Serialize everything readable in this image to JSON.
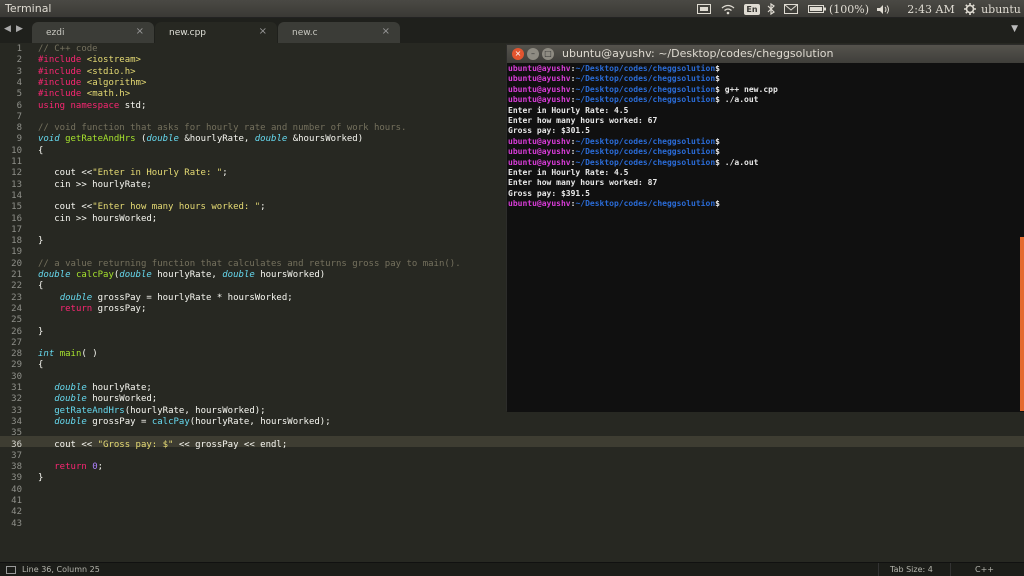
{
  "topbar": {
    "title": "Terminal",
    "tray": {
      "keyboard_layout": "En",
      "battery": "(100%)",
      "time": "2:43 AM",
      "user": "ubuntu",
      "icons": [
        "video-icon",
        "wifi-icon",
        "keyboard-icon",
        "bluetooth-icon",
        "mail-icon",
        "battery-icon",
        "volume-icon",
        "settings-gear-icon"
      ]
    }
  },
  "tabs": [
    {
      "label": "ezdi",
      "close": "×"
    },
    {
      "label": "new.cpp",
      "close": "×"
    },
    {
      "label": "new.c",
      "close": "×"
    }
  ],
  "nav": {
    "back": "◀",
    "forward": "▶",
    "menu": "▼"
  },
  "editor": {
    "line_numbers": [
      "1",
      "2",
      "3",
      "4",
      "5",
      "6",
      "7",
      "8",
      "9",
      "10",
      "11",
      "12",
      "13",
      "14",
      "15",
      "16",
      "17",
      "18",
      "19",
      "20",
      "21",
      "22",
      "23",
      "24",
      "25",
      "26",
      "27",
      "28",
      "29",
      "30",
      "31",
      "32",
      "33",
      "34",
      "35",
      "36",
      "37",
      "38",
      "39",
      "40",
      "41",
      "42",
      "43"
    ],
    "code": [
      [
        {
          "t": "// C++ code",
          "c": "cm"
        }
      ],
      [
        {
          "t": "#include ",
          "c": "kw"
        },
        {
          "t": "<iostream>",
          "c": "str"
        }
      ],
      [
        {
          "t": "#include ",
          "c": "kw"
        },
        {
          "t": "<stdio.h>",
          "c": "str"
        }
      ],
      [
        {
          "t": "#include ",
          "c": "kw"
        },
        {
          "t": "<algorithm>",
          "c": "str"
        }
      ],
      [
        {
          "t": "#include ",
          "c": "kw"
        },
        {
          "t": "<math.h>",
          "c": "str"
        }
      ],
      [
        {
          "t": "using namespace ",
          "c": "kw"
        },
        {
          "t": "std;",
          "c": ""
        }
      ],
      [],
      [
        {
          "t": "// void function that asks for hourly rate and number of work hours.",
          "c": "cm"
        }
      ],
      [
        {
          "t": "void ",
          "c": "ty"
        },
        {
          "t": "getRateAndHrs",
          "c": "fn"
        },
        {
          "t": " (",
          "c": ""
        },
        {
          "t": "double",
          "c": "ty"
        },
        {
          "t": " &hourlyRate, ",
          "c": ""
        },
        {
          "t": "double",
          "c": "ty"
        },
        {
          "t": " &hoursWorked)",
          "c": ""
        }
      ],
      [
        {
          "t": "{",
          "c": ""
        }
      ],
      [],
      [
        {
          "t": "   cout <<",
          "c": ""
        },
        {
          "t": "\"Enter in Hourly Rate: \"",
          "c": "str"
        },
        {
          "t": ";",
          "c": ""
        }
      ],
      [
        {
          "t": "   cin >> hourlyRate;",
          "c": ""
        }
      ],
      [],
      [
        {
          "t": "   cout <<",
          "c": ""
        },
        {
          "t": "\"Enter how many hours worked: \"",
          "c": "str"
        },
        {
          "t": ";",
          "c": ""
        }
      ],
      [
        {
          "t": "   cin >> hoursWorked;",
          "c": ""
        }
      ],
      [],
      [
        {
          "t": "}",
          "c": ""
        }
      ],
      [],
      [
        {
          "t": "// a value returning function that calculates and returns gross pay to main().",
          "c": "cm"
        }
      ],
      [
        {
          "t": "double ",
          "c": "ty"
        },
        {
          "t": "calcPay",
          "c": "fn"
        },
        {
          "t": "(",
          "c": ""
        },
        {
          "t": "double",
          "c": "ty"
        },
        {
          "t": " hourlyRate, ",
          "c": ""
        },
        {
          "t": "double",
          "c": "ty"
        },
        {
          "t": " hoursWorked)",
          "c": ""
        }
      ],
      [
        {
          "t": "{",
          "c": ""
        }
      ],
      [
        {
          "t": "    ",
          "c": ""
        },
        {
          "t": "double",
          "c": "ty"
        },
        {
          "t": " grossPay = hourlyRate * hoursWorked;",
          "c": ""
        }
      ],
      [
        {
          "t": "    ",
          "c": ""
        },
        {
          "t": "return",
          "c": "kw"
        },
        {
          "t": " grossPay;",
          "c": ""
        }
      ],
      [],
      [
        {
          "t": "}",
          "c": ""
        }
      ],
      [],
      [
        {
          "t": "int ",
          "c": "ty"
        },
        {
          "t": "main",
          "c": "fn"
        },
        {
          "t": "( )",
          "c": ""
        }
      ],
      [
        {
          "t": "{",
          "c": ""
        }
      ],
      [],
      [
        {
          "t": "   ",
          "c": ""
        },
        {
          "t": "double",
          "c": "ty"
        },
        {
          "t": " hourlyRate;",
          "c": ""
        }
      ],
      [
        {
          "t": "   ",
          "c": ""
        },
        {
          "t": "double",
          "c": "ty"
        },
        {
          "t": " hoursWorked;",
          "c": ""
        }
      ],
      [
        {
          "t": "   ",
          "c": ""
        },
        {
          "t": "getRateAndHrs",
          "c": "tp"
        },
        {
          "t": "(hourlyRate, hoursWorked);",
          "c": ""
        }
      ],
      [
        {
          "t": "   ",
          "c": ""
        },
        {
          "t": "double",
          "c": "ty"
        },
        {
          "t": " grossPay = ",
          "c": ""
        },
        {
          "t": "calcPay",
          "c": "tp"
        },
        {
          "t": "(hourlyRate, hoursWorked);",
          "c": ""
        }
      ],
      [],
      [
        {
          "t": "   cout << ",
          "c": ""
        },
        {
          "t": "\"Gross pay: $\"",
          "c": "str"
        },
        {
          "t": " << grossPay << endl;",
          "c": ""
        }
      ],
      [],
      [
        {
          "t": "   ",
          "c": ""
        },
        {
          "t": "return",
          "c": "kw"
        },
        {
          "t": " ",
          "c": ""
        },
        {
          "t": "0",
          "c": "num"
        },
        {
          "t": ";",
          "c": ""
        }
      ],
      [
        {
          "t": "}",
          "c": ""
        }
      ],
      [],
      [],
      [],
      []
    ]
  },
  "statusbar": {
    "position": "Line 36, Column 25",
    "tab_size": "Tab Size: 4",
    "syntax": "C++"
  },
  "terminal": {
    "title": "ubuntu@ayushv: ~/Desktop/codes/cheggsolution",
    "buttons": {
      "close": "×",
      "minimize": "–",
      "maximize": "□"
    },
    "lines": [
      {
        "user": "ubuntu@ayushv",
        "path": "~/Desktop/codes/cheggsolution",
        "cmd": ""
      },
      {
        "user": "ubuntu@ayushv",
        "path": "~/Desktop/codes/cheggsolution",
        "cmd": ""
      },
      {
        "user": "ubuntu@ayushv",
        "path": "~/Desktop/codes/cheggsolution",
        "cmd": " g++ new.cpp"
      },
      {
        "user": "ubuntu@ayushv",
        "path": "~/Desktop/codes/cheggsolution",
        "cmd": " ./a.out"
      },
      {
        "out": "Enter in Hourly Rate: 4.5"
      },
      {
        "out": "Enter how many hours worked: 67"
      },
      {
        "out": "Gross pay: $301.5"
      },
      {
        "user": "ubuntu@ayushv",
        "path": "~/Desktop/codes/cheggsolution",
        "cmd": ""
      },
      {
        "user": "ubuntu@ayushv",
        "path": "~/Desktop/codes/cheggsolution",
        "cmd": ""
      },
      {
        "user": "ubuntu@ayushv",
        "path": "~/Desktop/codes/cheggsolution",
        "cmd": " ./a.out"
      },
      {
        "out": "Enter in Hourly Rate: 4.5"
      },
      {
        "out": "Enter how many hours worked: 87"
      },
      {
        "out": "Gross pay: $391.5"
      },
      {
        "user": "ubuntu@ayushv",
        "path": "~/Desktop/codes/cheggsolution",
        "cmd": ""
      }
    ]
  },
  "colors": {
    "editor_bg": "#272822",
    "terminal_bg": "#101010",
    "prompt_user": "#d73cd7",
    "prompt_path": "#2a6bd6"
  }
}
